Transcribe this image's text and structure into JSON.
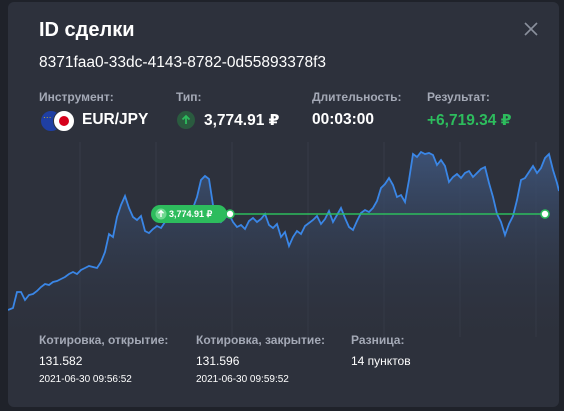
{
  "modal": {
    "title": "ID сделки",
    "deal_id": "8371faa0-33dc-4143-8782-0d55893378f3"
  },
  "info": {
    "instrument_label": "Инструмент:",
    "instrument_value": "EUR/JPY",
    "type_label": "Тип:",
    "type_value": "3,774.91 ₽",
    "duration_label": "Длительность:",
    "duration_value": "00:03:00",
    "result_label": "Результат:",
    "result_value": "+6,719.34 ₽"
  },
  "chart": {
    "pin_label": "3,774.91 ₽",
    "line_color": "#3a86e6",
    "fill_color": "#3d4f70",
    "deal_color": "#2dbc5d"
  },
  "quotes": {
    "open_label": "Котировка, открытие:",
    "open_value": "131.582",
    "open_time": "2021-06-30 09:56:52",
    "close_label": "Котировка, закрытие:",
    "close_value": "131.596",
    "close_time": "2021-06-30 09:59:52",
    "diff_label": "Разница:",
    "diff_value": "14 пунктов"
  },
  "icons": {
    "close": "close-icon",
    "up": "arrow-up-icon",
    "flags": "eur-jpy-flags-icon"
  }
}
